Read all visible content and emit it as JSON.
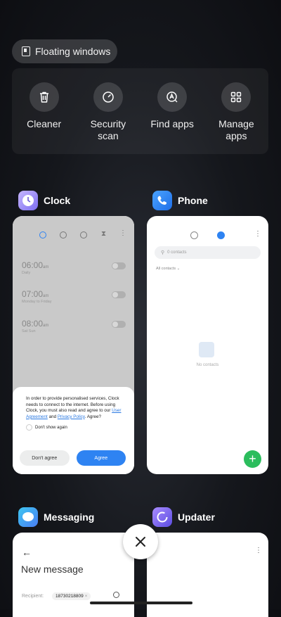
{
  "floating_windows": {
    "label": "Floating windows"
  },
  "tools": [
    {
      "label": "Cleaner",
      "icon": "trash-icon"
    },
    {
      "label": "Security scan",
      "icon": "security-icon"
    },
    {
      "label": "Find apps",
      "icon": "find-apps-icon"
    },
    {
      "label": "Manage apps",
      "icon": "grid-icon"
    }
  ],
  "apps": {
    "clock": {
      "name": "Clock",
      "alarms": [
        {
          "time": "06:00",
          "ampm": "am",
          "repeat": "Daily"
        },
        {
          "time": "07:00",
          "ampm": "am",
          "repeat": "Monday to Friday"
        },
        {
          "time": "08:00",
          "ampm": "am",
          "repeat": "Sat Sun"
        }
      ],
      "dialog": {
        "message": "In order to provide personalised services, Clock needs to connect to the internet. Before using Clock, you must also read and agree to our",
        "link1": "User Agreement",
        "and": "and",
        "link2": "Privacy Policy",
        "agree_q": ". Agree?",
        "dont_show": "Don't show again",
        "dont_agree": "Don't agree",
        "agree": "Agree"
      }
    },
    "phone": {
      "name": "Phone",
      "search_placeholder": "0 contacts",
      "all_contacts": "All contacts",
      "empty": "No contacts"
    },
    "messaging": {
      "name": "Messaging",
      "title": "New message",
      "recipient_label": "Recipient:",
      "recipient_value": "18730218809"
    },
    "updater": {
      "name": "Updater"
    }
  },
  "colors": {
    "accent_blue": "#2e83f2",
    "fab_green": "#2bbd5d"
  }
}
